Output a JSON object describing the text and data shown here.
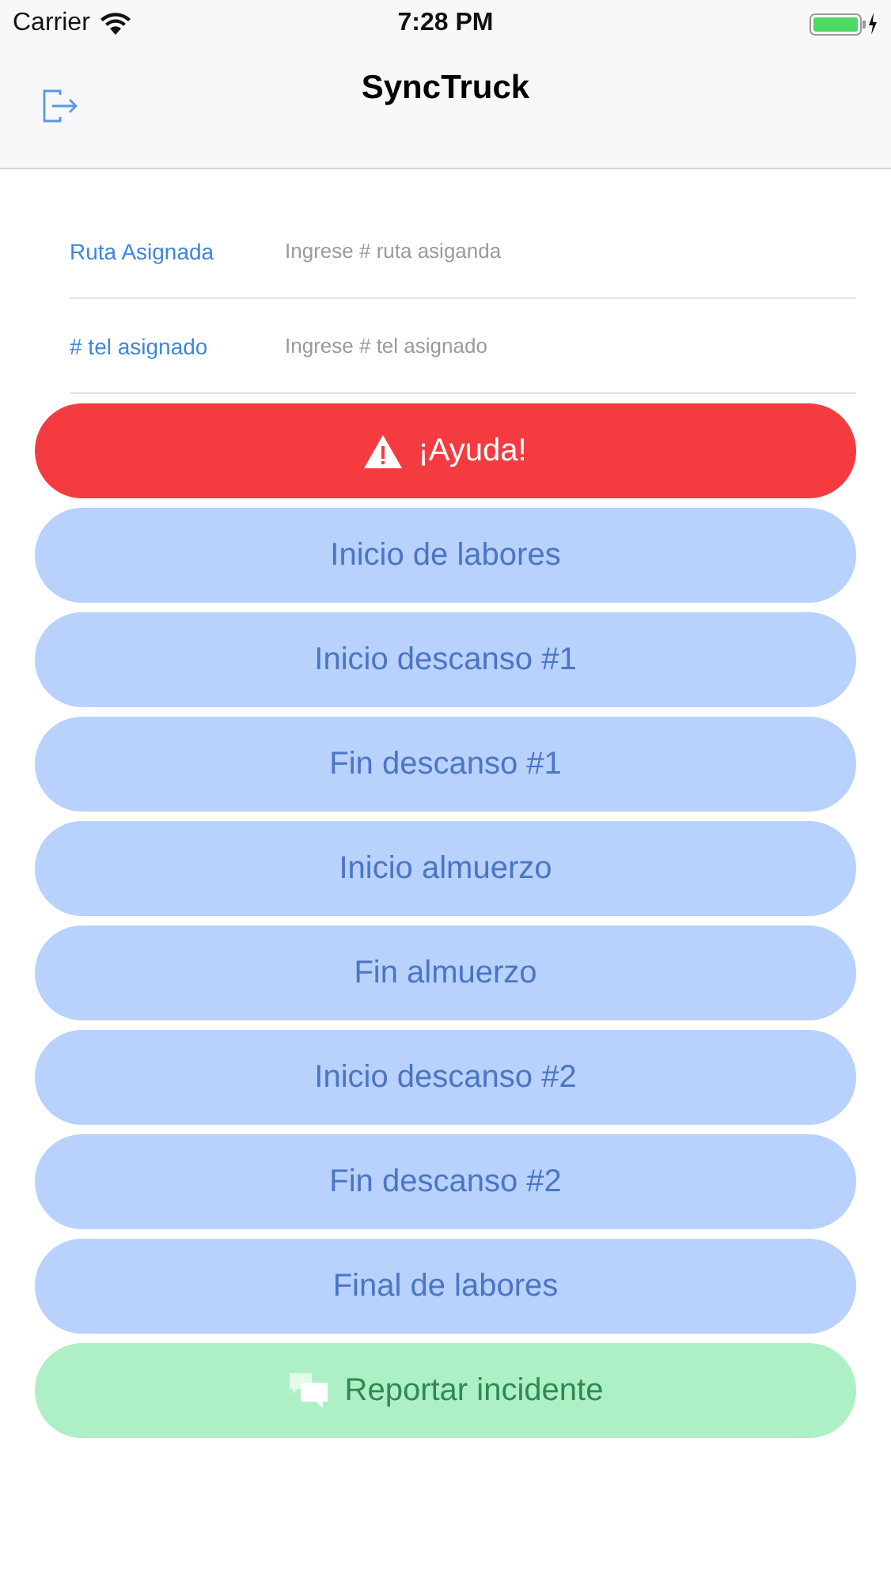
{
  "status_bar": {
    "carrier": "Carrier",
    "time": "7:28 PM"
  },
  "nav": {
    "title": "SyncTruck"
  },
  "fields": [
    {
      "label": "Ruta Asignada",
      "placeholder": "Ingrese # ruta asiganda"
    },
    {
      "label": "# tel asignado",
      "placeholder": "Ingrese # tel asignado"
    }
  ],
  "buttons": [
    {
      "label": "¡Ayuda!",
      "kind": "alert",
      "disabled": false
    },
    {
      "label": "Inicio de labores",
      "kind": "task",
      "disabled": true
    },
    {
      "label": "Inicio descanso #1",
      "kind": "task",
      "disabled": true
    },
    {
      "label": "Fin descanso #1",
      "kind": "task",
      "disabled": true
    },
    {
      "label": "Inicio almuerzo",
      "kind": "task",
      "disabled": true
    },
    {
      "label": "Fin almuerzo",
      "kind": "task",
      "disabled": true
    },
    {
      "label": "Inicio descanso #2",
      "kind": "task",
      "disabled": true
    },
    {
      "label": "Fin descanso #2",
      "kind": "task",
      "disabled": true
    },
    {
      "label": "Final de labores",
      "kind": "task",
      "disabled": true
    },
    {
      "label": "Reportar incidente",
      "kind": "report",
      "disabled": true
    }
  ]
}
